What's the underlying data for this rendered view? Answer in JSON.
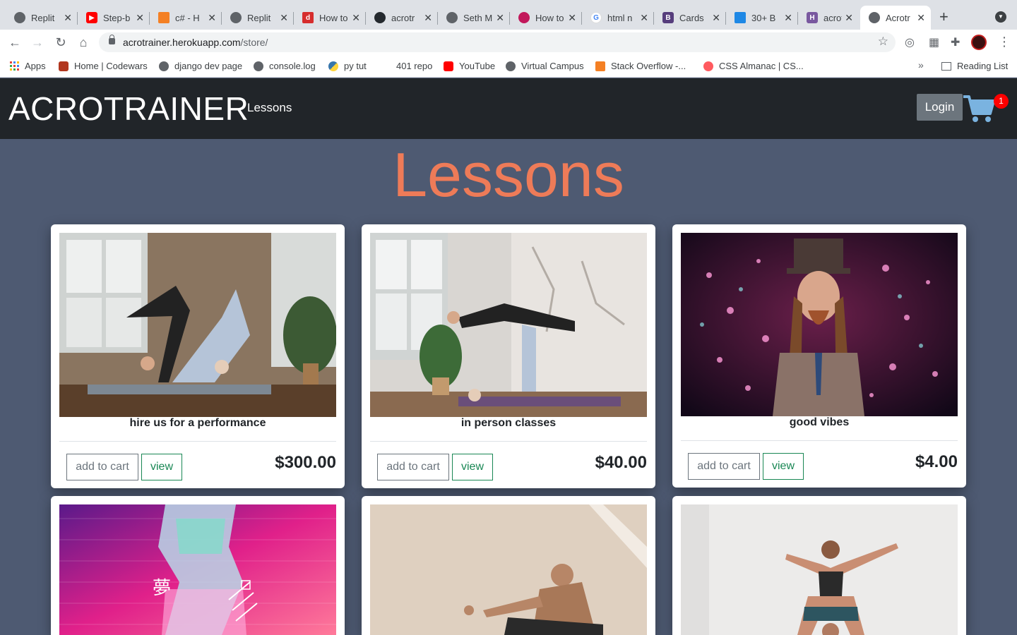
{
  "browser": {
    "tabs": [
      {
        "label": "Replit",
        "icon": "replit-icon",
        "color": "#5f6368"
      },
      {
        "label": "Step-b",
        "icon": "youtube-icon",
        "color": "#ff0000"
      },
      {
        "label": "c# - H",
        "icon": "stackoverflow-icon",
        "color": "#f48024"
      },
      {
        "label": "Replit",
        "icon": "replit-icon",
        "color": "#5f6368"
      },
      {
        "label": "How to",
        "icon": "dev-icon",
        "color": "#d62d2d"
      },
      {
        "label": "acrotr",
        "icon": "github-icon",
        "color": "#24292e"
      },
      {
        "label": "Seth M",
        "icon": "globe-icon",
        "color": "#5f6368"
      },
      {
        "label": "How to",
        "icon": "puzzle-icon",
        "color": "#c2185b"
      },
      {
        "label": "html n",
        "icon": "google-icon",
        "color": "#4285f4"
      },
      {
        "label": "Cards",
        "icon": "bootstrap-icon",
        "color": "#563d7c"
      },
      {
        "label": "30+ B",
        "icon": "uiverse-icon",
        "color": "#1e88e5"
      },
      {
        "label": "acrotr",
        "icon": "heroku-icon",
        "color": "#79589f"
      },
      {
        "label": "Acrotr",
        "icon": "globe-icon",
        "color": "#5f6368"
      }
    ],
    "url_host": "acrotrainer.herokuapp.com",
    "url_path": "/store/",
    "bookmarks": [
      {
        "label": "Apps",
        "color": "#4285f4"
      },
      {
        "label": "Home | Codewars",
        "color": "#b1361e"
      },
      {
        "label": "django dev page",
        "color": "#5f6368"
      },
      {
        "label": "console.log",
        "color": "#5f6368"
      },
      {
        "label": "py tut",
        "color": "#3776ab"
      },
      {
        "label": "401 repo",
        "color": "#ffffff"
      },
      {
        "label": "YouTube",
        "color": "#ff0000"
      },
      {
        "label": "Virtual Campus",
        "color": "#5f6368"
      },
      {
        "label": "Stack Overflow -...",
        "color": "#f48024"
      },
      {
        "label": "CSS Almanac | CS...",
        "color": "#ff5a5f"
      }
    ],
    "reading_list": "Reading List"
  },
  "site": {
    "brand": "ACROTRAINER",
    "nav_link": "Lessons",
    "login_label": "Login",
    "cart_count": "1",
    "page_title": "Lessons"
  },
  "cards": [
    {
      "title": "hire us for a performance",
      "price": "$300.00",
      "add_label": "add to cart",
      "view_label": "view"
    },
    {
      "title": "in person classes",
      "price": "$40.00",
      "add_label": "add to cart",
      "view_label": "view"
    },
    {
      "title": "good vibes",
      "price": "$4.00",
      "add_label": "add to cart",
      "view_label": "view"
    },
    {
      "title": "",
      "price": "",
      "add_label": "",
      "view_label": ""
    },
    {
      "title": "",
      "price": "",
      "add_label": "",
      "view_label": ""
    },
    {
      "title": "",
      "price": "",
      "add_label": "",
      "view_label": ""
    }
  ],
  "colors": {
    "page_bg": "#4e5a72",
    "navbar_bg": "#212529",
    "title_accent": "#ee7b58",
    "view_green": "#198754",
    "badge_red": "#ff0000"
  }
}
